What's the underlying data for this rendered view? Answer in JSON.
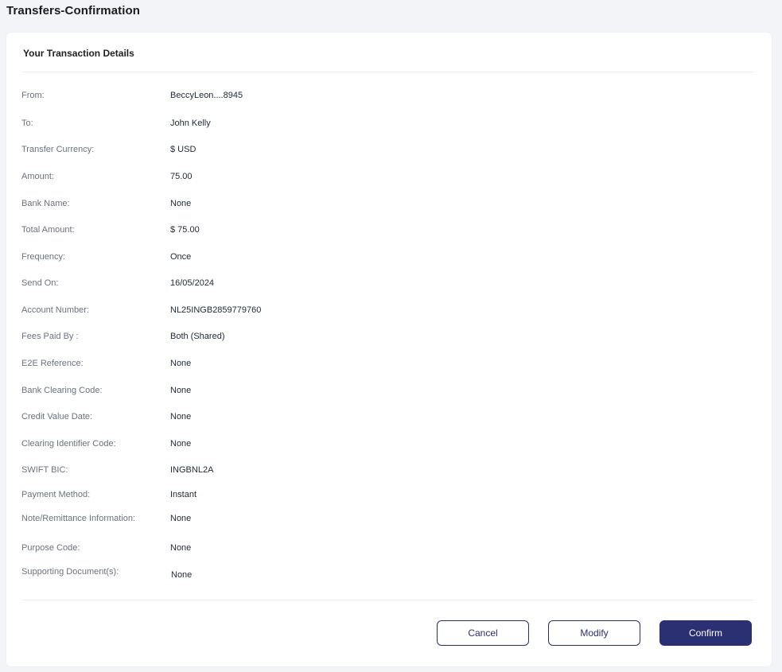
{
  "header": {
    "title": "Transfers-Confirmation"
  },
  "card": {
    "title": "Your Transaction Details",
    "rows": [
      {
        "label": "From:",
        "value": "BeccyLeon....8945"
      },
      {
        "label": "To:",
        "value": "John Kelly"
      },
      {
        "label": "Transfer Currency:",
        "value": "$ USD"
      },
      {
        "label": "Amount:",
        "value": "75.00"
      },
      {
        "label": "Bank Name:",
        "value": "None"
      },
      {
        "label": "Total Amount:",
        "value": "$ 75.00"
      },
      {
        "label": "Frequency:",
        "value": "Once"
      },
      {
        "label": "Send On:",
        "value": "16/05/2024"
      },
      {
        "label": "Account Number:",
        "value": "NL25INGB2859779760"
      },
      {
        "label": "Fees Paid By :",
        "value": "Both (Shared)"
      },
      {
        "label": "E2E Reference:",
        "value": "None"
      },
      {
        "label": "Bank Clearing Code:",
        "value": "None"
      },
      {
        "label": "Credit Value Date:",
        "value": "None"
      },
      {
        "label": "Clearing Identifier Code:",
        "value": "None"
      },
      {
        "label": "SWIFT BIC:",
        "value": "INGBNL2A"
      },
      {
        "label": "Payment Method:",
        "value": "Instant"
      },
      {
        "label": "Note/Remittance Information:",
        "value": "None"
      },
      {
        "label": "Purpose Code:",
        "value": "None"
      },
      {
        "label": "Supporting Document(s):",
        "value": "None"
      }
    ]
  },
  "actions": {
    "cancel_label": "Cancel",
    "modify_label": "Modify",
    "confirm_label": "Confirm"
  },
  "colors": {
    "primary": "#2b3072",
    "background": "#f3f4f7",
    "label_text": "#6b7280"
  }
}
